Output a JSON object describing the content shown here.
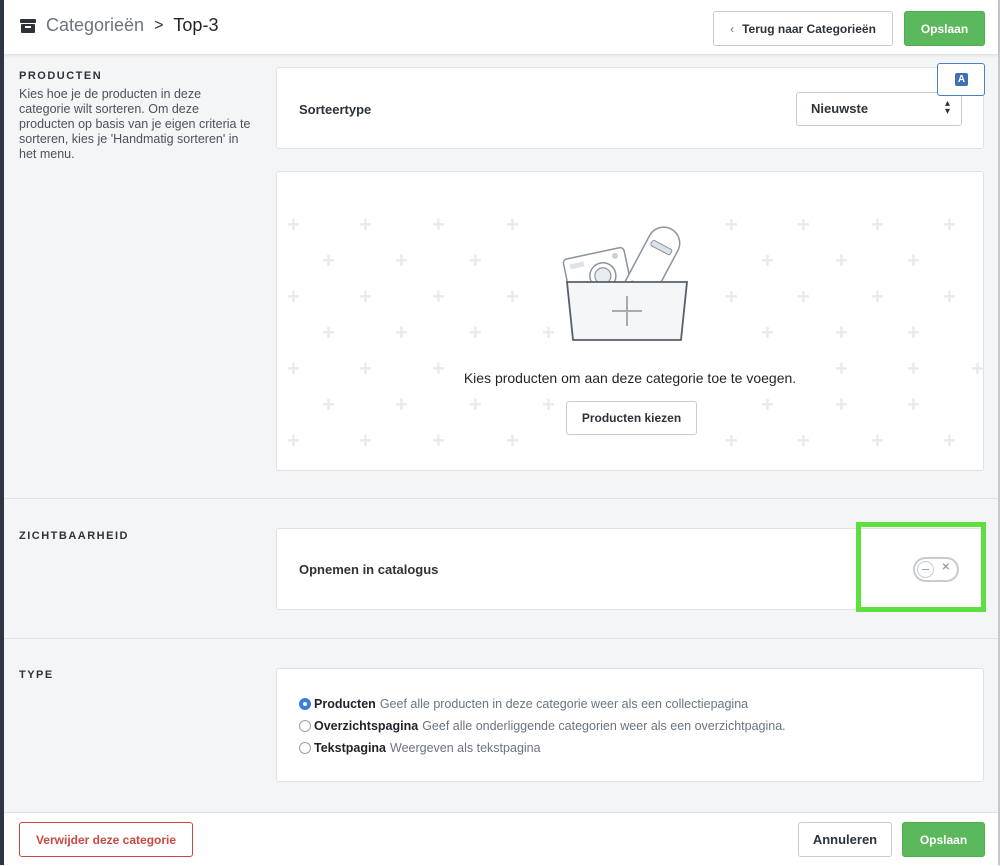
{
  "header": {
    "breadcrumb_parent": "Categorieën",
    "breadcrumb_separator": ">",
    "breadcrumb_current": "Top-3",
    "back_label": "Terug naar Categorieën",
    "save_label": "Opslaan"
  },
  "products_section": {
    "title": "PRODUCTEN",
    "description": "Kies hoe je de producten in deze categorie wilt sorteren. Om deze producten op basis van je eigen criteria te sorteren, kies je 'Handmatig sorteren' in het menu.",
    "sort_label": "Sorteertype",
    "sort_value": "Nieuwste",
    "lang_badge": "A",
    "empty_text": "Kies producten om aan deze categorie toe te voegen.",
    "pick_button": "Producten kiezen"
  },
  "visibility_section": {
    "title": "ZICHTBAARHEID",
    "toggle_label": "Opnemen in catalogus",
    "toggle_on": false
  },
  "type_section": {
    "title": "TYPE",
    "options": [
      {
        "label": "Producten",
        "desc": "Geef alle producten in deze categorie weer als een collectiepagina",
        "checked": true
      },
      {
        "label": "Overzichtspagina",
        "desc": "Geef alle onderliggende categorien weer als een overzichtpagina.",
        "checked": false
      },
      {
        "label": "Tekstpagina",
        "desc": "Weergeven als tekstpagina",
        "checked": false
      }
    ]
  },
  "footer": {
    "delete_label": "Verwijder deze categorie",
    "cancel_label": "Annuleren",
    "save_label": "Opslaan"
  },
  "colors": {
    "primary_green": "#5cb85c",
    "danger_red": "#c9483f",
    "radio_blue": "#3b7ddd",
    "highlight_green": "#5de03f"
  }
}
